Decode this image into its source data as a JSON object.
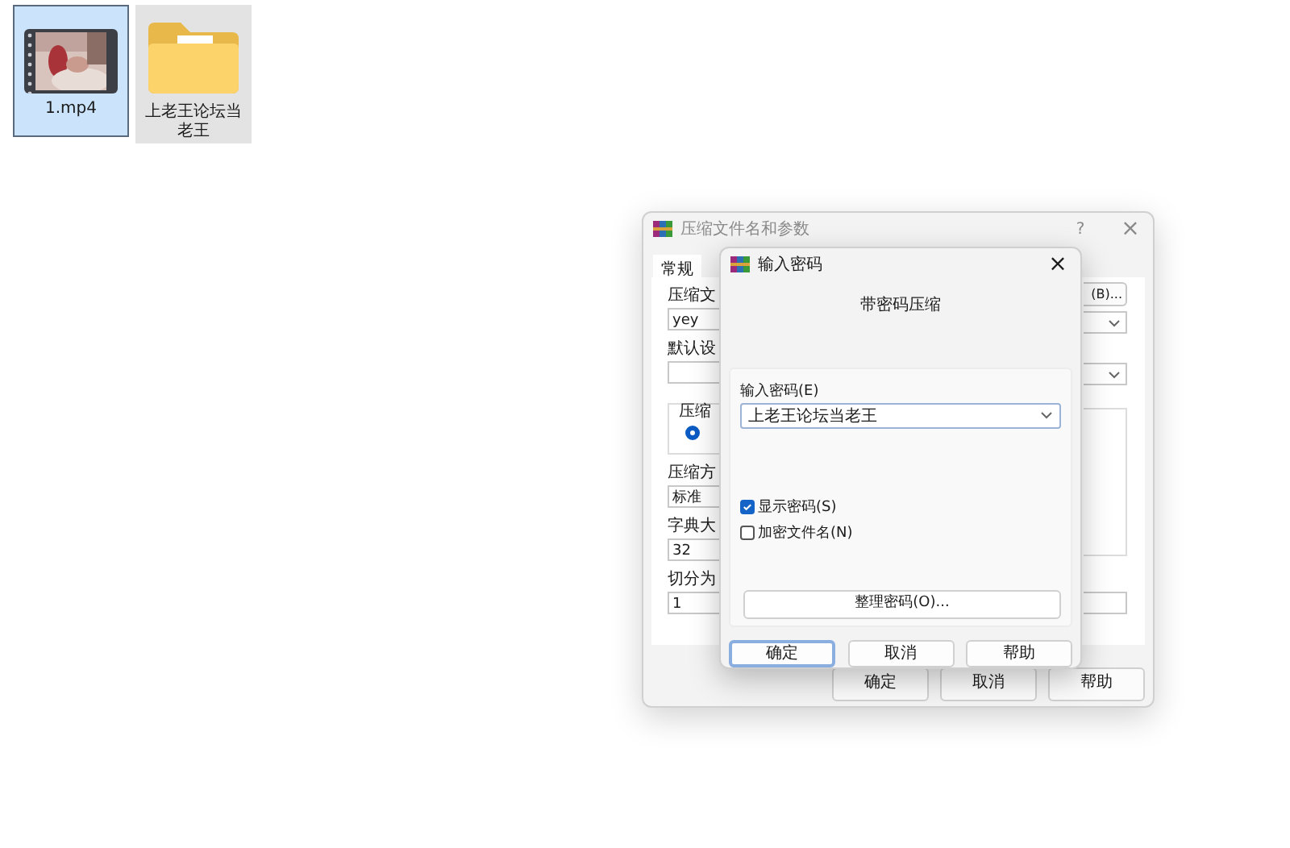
{
  "desktop_icons": [
    {
      "kind": "video",
      "label": "1.mp4",
      "selected": true
    },
    {
      "kind": "folder",
      "label": "上老王论坛当老王",
      "selected": false
    }
  ],
  "back_window": {
    "title": "压缩文件名和参数",
    "help": "?",
    "close": "×",
    "tabs": [
      {
        "label": "常规",
        "selected": true
      }
    ],
    "left_items": [
      {
        "kind": "label",
        "text": "压缩文"
      },
      {
        "kind": "field",
        "text": "yey"
      },
      {
        "kind": "label",
        "text": "默认设"
      },
      {
        "kind": "dropdown"
      },
      {
        "kind": "group",
        "text": "压缩",
        "radio_selected": true
      },
      {
        "kind": "label",
        "text": "压缩方"
      },
      {
        "kind": "field",
        "text": "标准"
      },
      {
        "kind": "label",
        "text": "字典大"
      },
      {
        "kind": "field",
        "text": "32"
      },
      {
        "kind": "label",
        "text": "切分为"
      },
      {
        "kind": "field",
        "text": "1"
      }
    ],
    "right_items": [
      {
        "kind": "button",
        "text": "(B)..."
      },
      {
        "kind": "dropdown"
      },
      {
        "kind": "dropdown"
      },
      {
        "kind": "group"
      },
      {
        "kind": "field"
      }
    ],
    "buttons": [
      "确定",
      "取消",
      "帮助"
    ]
  },
  "password_dialog": {
    "title": "输入密码",
    "close": "×",
    "heading": "带密码压缩",
    "password_label": "输入密码(E)",
    "password_value": "上老王论坛当老王",
    "checkboxes": [
      {
        "label": "显示密码(S)",
        "checked": true
      },
      {
        "label": "加密文件名(N)",
        "checked": false
      }
    ],
    "organize_button": "整理密码(O)...",
    "buttons": [
      {
        "label": "确定",
        "default": true
      },
      {
        "label": "取消",
        "default": false
      },
      {
        "label": "帮助",
        "default": false
      }
    ]
  }
}
